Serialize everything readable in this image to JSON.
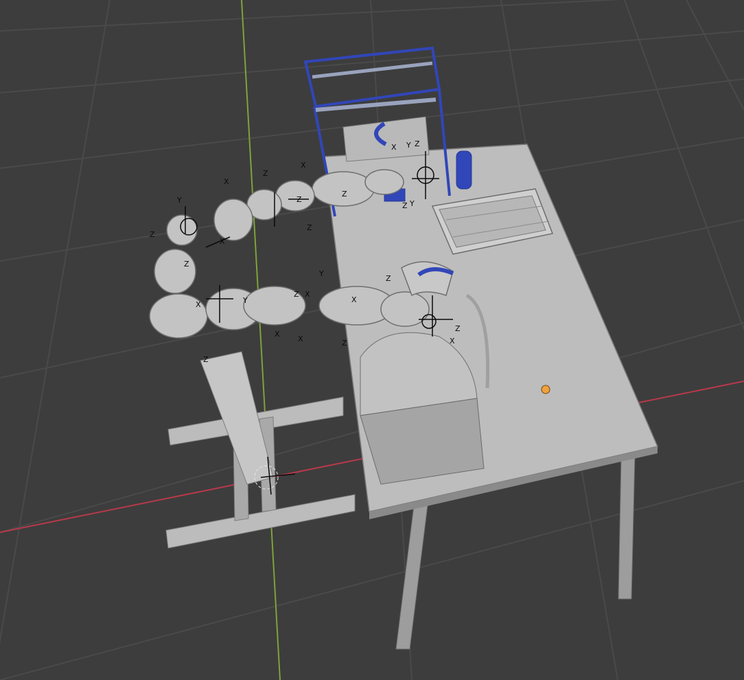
{
  "viewport": {
    "colors": {
      "background": "#3d3d3d",
      "grid": "#4a4a4a",
      "x_axis": "#b8394a",
      "y_axis": "#7ea33a",
      "mesh": "#b3b3b3",
      "mesh_shadow": "#8e8e8e",
      "accent_blue": "#3146b8",
      "origin": "#f0a03c"
    },
    "objects": [
      "table",
      "robot-stand",
      "dual-arm-robot",
      "3d-printer-frame",
      "tray",
      "printer-box",
      "light-point"
    ],
    "axis_letters": [
      "X",
      "Y",
      "Z"
    ]
  }
}
